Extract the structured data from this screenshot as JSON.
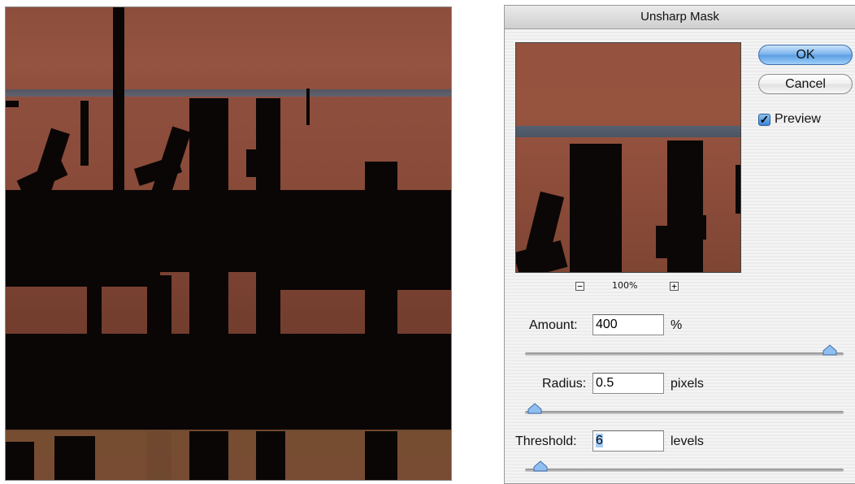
{
  "dialog": {
    "title": "Unsharp Mask",
    "ok_label": "OK",
    "cancel_label": "Cancel",
    "preview_label": "Preview",
    "preview_checked": true,
    "zoom_out_label": "−",
    "zoom_in_label": "+",
    "zoom_level": "100%",
    "amount": {
      "label": "Amount:",
      "value": "400",
      "unit": "%",
      "slider_fraction": 0.97
    },
    "radius": {
      "label": "Radius:",
      "value": "0.5",
      "unit": "pixels",
      "slider_fraction": 0.0
    },
    "threshold": {
      "label": "Threshold:",
      "value": "6",
      "unit": "levels",
      "slider_fraction": 0.02
    }
  },
  "colors": {
    "accent_button": "#5e9fe4",
    "selection": "#a8cdf5"
  },
  "icons": {
    "preview_checkbox": "checkmark-icon",
    "slider_thumb": "triangle-thumb-icon"
  }
}
